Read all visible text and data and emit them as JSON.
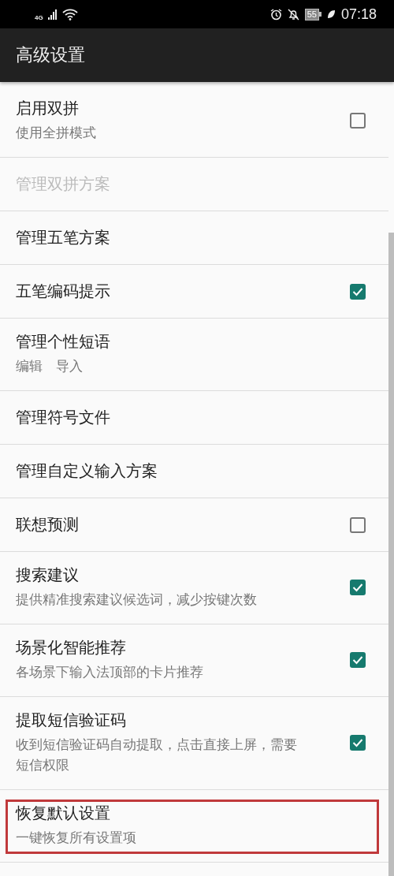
{
  "status_bar": {
    "network": "4G",
    "battery": "55",
    "time": "07:18"
  },
  "app_bar": {
    "title": "高级设置"
  },
  "rows": [
    {
      "title": "启用双拼",
      "summary": "使用全拼模式",
      "kind": "checkbox",
      "checked": false,
      "disabled": false,
      "highlighted": false
    },
    {
      "title": "管理双拼方案",
      "kind": "plain",
      "disabled": true,
      "highlighted": false
    },
    {
      "title": "管理五笔方案",
      "kind": "plain",
      "disabled": false,
      "highlighted": false
    },
    {
      "title": "五笔编码提示",
      "kind": "checkbox",
      "checked": true,
      "disabled": false,
      "highlighted": false
    },
    {
      "title": "管理个性短语",
      "summary": "编辑　导入",
      "kind": "plain",
      "disabled": false,
      "highlighted": false
    },
    {
      "title": "管理符号文件",
      "kind": "plain",
      "disabled": false,
      "highlighted": false
    },
    {
      "title": "管理自定义输入方案",
      "kind": "plain",
      "disabled": false,
      "highlighted": false
    },
    {
      "title": "联想预测",
      "kind": "checkbox",
      "checked": false,
      "disabled": false,
      "highlighted": false
    },
    {
      "title": "搜索建议",
      "summary": "提供精准搜索建议候选词，减少按键次数",
      "kind": "checkbox",
      "checked": true,
      "disabled": false,
      "highlighted": false
    },
    {
      "title": "场景化智能推荐",
      "summary": "各场景下输入法顶部的卡片推荐",
      "kind": "checkbox",
      "checked": true,
      "disabled": false,
      "highlighted": false
    },
    {
      "title": "提取短信验证码",
      "summary": "收到短信验证码自动提取，点击直接上屏，需要短信权限",
      "kind": "checkbox",
      "checked": true,
      "disabled": false,
      "highlighted": false
    },
    {
      "title": "恢复默认设置",
      "summary": "一键恢复所有设置项",
      "kind": "plain",
      "disabled": false,
      "highlighted": true
    }
  ]
}
